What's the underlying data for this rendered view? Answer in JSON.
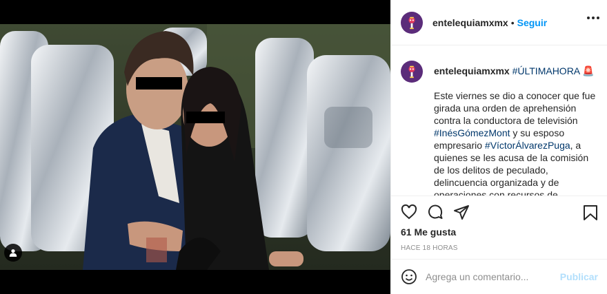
{
  "post": {
    "username": "entelequiamxmx",
    "follow_label": "Seguir",
    "separator": "•",
    "caption": {
      "hashtag": "#ÚLTIMAHORA",
      "emoji": "🚨",
      "text_1": "Este viernes se dio a conocer que fue girada una orden de aprehensión contra la conductora de televisión ",
      "hashtag_2": "#InésGómezMont",
      "text_2": " y su esposo empresario ",
      "hashtag_3": "#VíctorÁlvarezPuga",
      "text_3": ", a quienes se les acusa de la comisión de los delitos de peculado, delincuencia organizada y de operaciones con recursos de procedencia ilícita. De"
    },
    "likes": "61 Me gusta",
    "time_ago": "HACE 18 HORAS"
  },
  "comment": {
    "placeholder": "Agrega un comentario...",
    "publish_label": "Publicar"
  },
  "icons": {
    "avatar": "avatar-logo-icon",
    "more": "more-options-icon",
    "like": "heart-icon",
    "comment": "comment-bubble-icon",
    "share": "paper-plane-icon",
    "save": "bookmark-icon",
    "emoji": "emoji-face-icon",
    "user_tag": "user-tag-icon"
  },
  "colors": {
    "link": "#0095f6",
    "hashtag": "#00376b",
    "publish_disabled": "#b2dffc",
    "avatar_bg": "#5b2c7a"
  }
}
